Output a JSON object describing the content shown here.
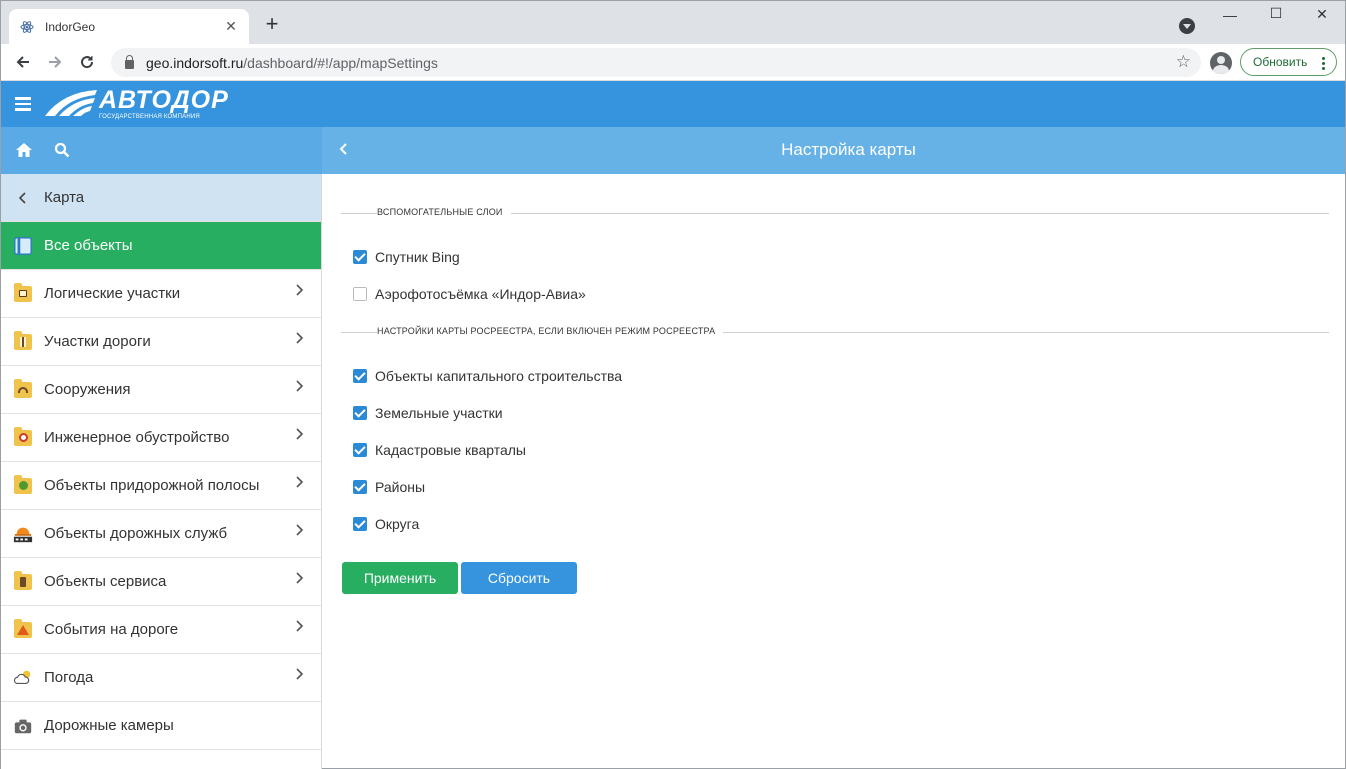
{
  "browser": {
    "tab_title": "IndorGeo",
    "url_host": "geo.indorsoft.ru",
    "url_path": "/dashboard/#!/app/mapSettings",
    "update_label": "Обновить"
  },
  "app": {
    "logo_text": "АВТОДОР",
    "logo_subtext": "ГОСУДАРСТВЕННАЯ КОМПАНИЯ",
    "page_title": "Настройка карты",
    "accent_color": "#3594dd",
    "active_color": "#27ae60"
  },
  "sidebar": {
    "items": [
      {
        "label": "Карта",
        "icon": "chevron-left-icon"
      },
      {
        "label": "Все объекты",
        "icon": "map-book-icon"
      },
      {
        "label": "Логические участки",
        "icon": "folder-icon"
      },
      {
        "label": "Участки дороги",
        "icon": "folder-road-icon"
      },
      {
        "label": "Сооружения",
        "icon": "folder-bridge-icon"
      },
      {
        "label": "Инженерное обустройство",
        "icon": "folder-sign-icon"
      },
      {
        "label": "Объекты придорожной полосы",
        "icon": "folder-tree-icon"
      },
      {
        "label": "Объекты дорожных служб",
        "icon": "road-service-icon"
      },
      {
        "label": "Объекты сервиса",
        "icon": "folder-fuel-icon"
      },
      {
        "label": "События на дороге",
        "icon": "folder-warning-icon"
      },
      {
        "label": "Погода",
        "icon": "weather-icon"
      },
      {
        "label": "Дорожные камеры",
        "icon": "camera-icon"
      }
    ]
  },
  "settings": {
    "section1_label": "вспомогательные слои",
    "section1_items": [
      {
        "label": "Спутник Bing",
        "checked": true
      },
      {
        "label": "Аэрофотосъёмка «Индор-Авиа»",
        "checked": false
      }
    ],
    "section2_label": "настройки карты росреестра, если включен режим росреестра",
    "section2_items": [
      {
        "label": "Объекты капитального строительства",
        "checked": true
      },
      {
        "label": "Земельные участки",
        "checked": true
      },
      {
        "label": "Кадастровые кварталы",
        "checked": true
      },
      {
        "label": "Районы",
        "checked": true
      },
      {
        "label": "Округа",
        "checked": true
      }
    ],
    "apply_label": "Применить",
    "reset_label": "Сбросить"
  }
}
